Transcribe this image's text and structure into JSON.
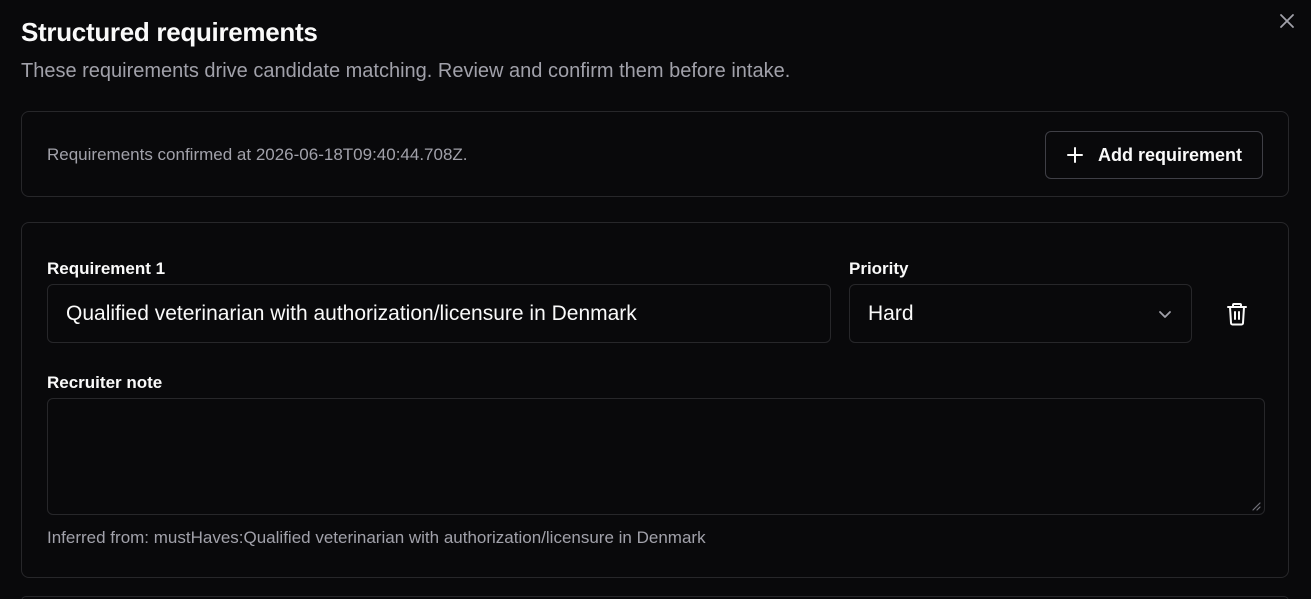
{
  "dialog": {
    "title": "Structured requirements",
    "subtitle": "These requirements drive candidate matching. Review and confirm them before intake.",
    "close_icon": "close-icon"
  },
  "confirmation": {
    "text": "Requirements confirmed at 2026-06-18T09:40:44.708Z.",
    "add_button_label": "Add requirement",
    "add_icon": "plus-icon"
  },
  "requirements": [
    {
      "label": "Requirement 1",
      "value": "Qualified veterinarian with authorization/licensure in Denmark",
      "priority_label": "Priority",
      "priority_value": "Hard",
      "note_label": "Recruiter note",
      "note_value": "",
      "inferred_from": "Inferred from: mustHaves:Qualified veterinarian with authorization/licensure in Denmark"
    }
  ],
  "colors": {
    "background": "#09090b",
    "border": "#27272a",
    "text": "#fafafa",
    "muted_text": "#a1a1aa"
  }
}
